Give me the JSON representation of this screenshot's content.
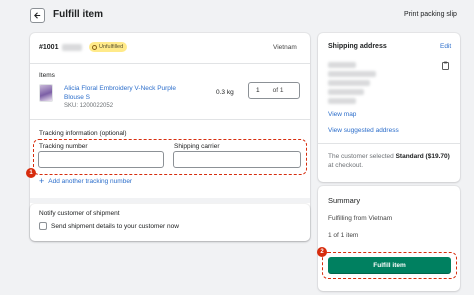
{
  "header": {
    "title": "Fulfill item",
    "print_label": "Print packing slip"
  },
  "order": {
    "number": "#1001",
    "status": "Unfulfilled",
    "country": "Vietnam"
  },
  "items": {
    "section_label": "Items",
    "product_name": "Alicia Floral Embroidery V-Neck Purple Blouse S",
    "sku": "SKU: 1200022052",
    "weight": "0.3 kg",
    "quantity": "1",
    "quantity_of": "of 1"
  },
  "tracking": {
    "section_label": "Tracking information (optional)",
    "number_label": "Tracking number",
    "carrier_label": "Shipping carrier",
    "add_another": "Add another tracking number"
  },
  "notify": {
    "title": "Notify customer of shipment",
    "checkbox_label": "Send shipment details to your customer now"
  },
  "shipping": {
    "title": "Shipping address",
    "edit_label": "Edit",
    "view_map": "View map",
    "view_suggested": "View suggested address",
    "selected_prefix": "The customer selected",
    "selected_method": "Standard ($19.70)",
    "selected_suffix": "at checkout."
  },
  "summary": {
    "title": "Summary",
    "fulfilling_from": "Fulfilling from Vietnam",
    "count": "1 of 1 item",
    "fulfill_button": "Fulfill item"
  },
  "markers": {
    "first": "1",
    "second": "2"
  },
  "colors": {
    "accent": "#2c6ecb",
    "primary_button": "#008060",
    "highlight": "#d72c0d",
    "badge": "#ffea8a"
  }
}
